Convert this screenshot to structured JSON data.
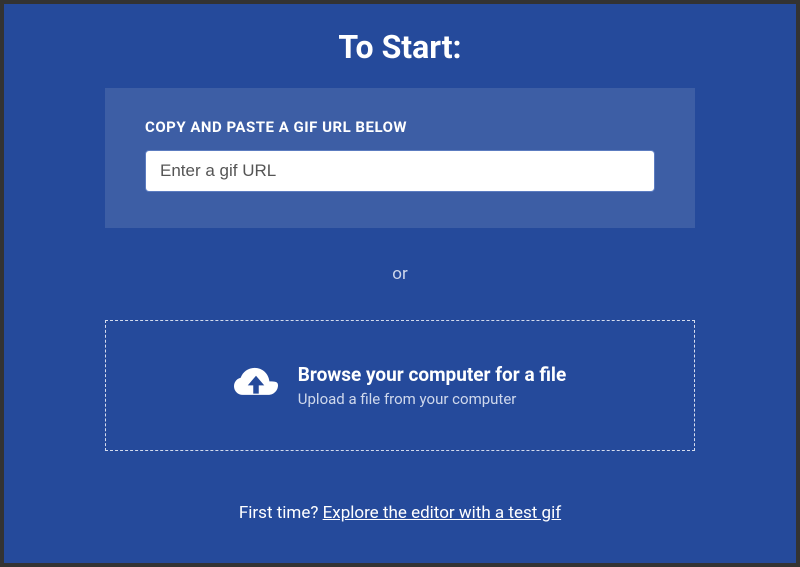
{
  "title": "To Start:",
  "url_section": {
    "label": "COPY AND PASTE A GIF URL BELOW",
    "placeholder": "Enter a gif URL",
    "value": ""
  },
  "separator": "or",
  "upload_section": {
    "title": "Browse your computer for a file",
    "subtitle": "Upload a file from your computer",
    "icon": "cloud-upload-icon"
  },
  "first_time": {
    "prefix": "First time? ",
    "link_text": "Explore the editor with a test gif"
  },
  "colors": {
    "background": "#254a9b",
    "panel": "#3d5ea5",
    "outer": "#333333"
  }
}
